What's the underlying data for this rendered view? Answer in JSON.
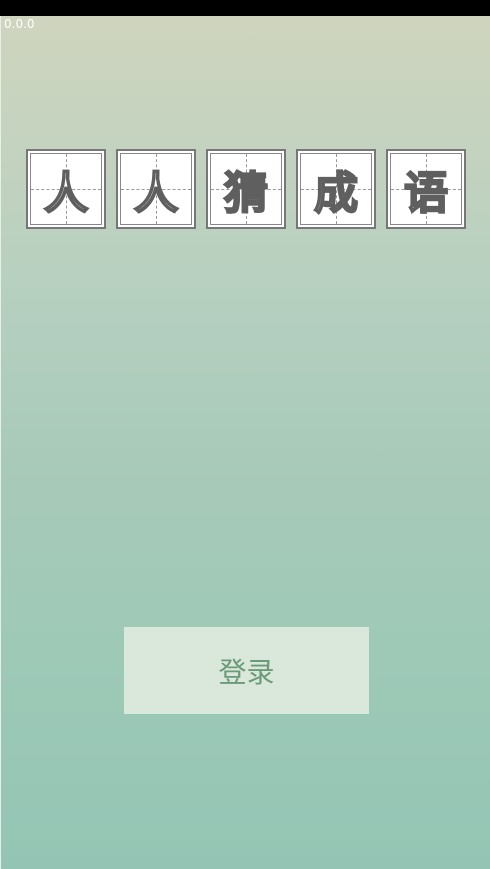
{
  "app": {
    "version": "0.0.0",
    "title_chars": [
      "人",
      "人",
      "猜",
      "成",
      "语"
    ]
  },
  "login": {
    "label": "登录"
  },
  "colors": {
    "gradient_top": "#cfd4be",
    "gradient_bottom": "#94c5b4",
    "button_bg": "#d9e8da",
    "button_text": "#6b9a79",
    "tile_border": "#777777"
  }
}
